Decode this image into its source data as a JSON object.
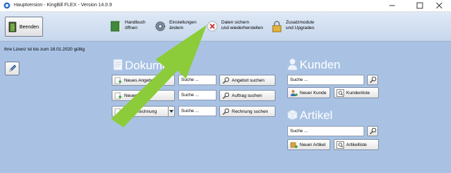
{
  "window": {
    "title": "Hauptversion - KingBill FLEX - Version 14.0.9"
  },
  "toolbar": {
    "exit_label": "Beenden",
    "items": [
      {
        "line1": "Handbuch",
        "line2": "öffnen"
      },
      {
        "line1": "Einstellungen",
        "line2": "ändern"
      },
      {
        "line1": "Daten sichern",
        "line2": "und wiederherstellen"
      },
      {
        "line1": "Zusatzmodule",
        "line2": "und Upgrades"
      }
    ]
  },
  "license_text": "Ihre Lizenz ist bis zum 18.01.2020 gültig",
  "documents": {
    "heading": "Dokumente",
    "rows": [
      {
        "new_label": "Neues Angebot",
        "search_placeholder": "Suche ...",
        "search_button": "Angebot suchen"
      },
      {
        "new_label": "Neuer Auftrag",
        "search_placeholder": "Suche ...",
        "search_button": "Auftrag suchen"
      },
      {
        "new_label": "Neue Rechnung",
        "search_placeholder": "Suche ...",
        "search_button": "Rechnung suchen"
      }
    ]
  },
  "customers": {
    "heading": "Kunden",
    "search_placeholder": "Suche ...",
    "new_label": "Neuer Kunde",
    "list_label": "Kundenliste"
  },
  "articles": {
    "heading": "Artikel",
    "search_placeholder": "Suche ...",
    "new_label": "Neuer Artikel",
    "list_label": "Artikelliste"
  },
  "colors": {
    "background": "#a9c2e4",
    "toolbar": "#d3e0f1",
    "arrow": "#8ccc3a"
  }
}
